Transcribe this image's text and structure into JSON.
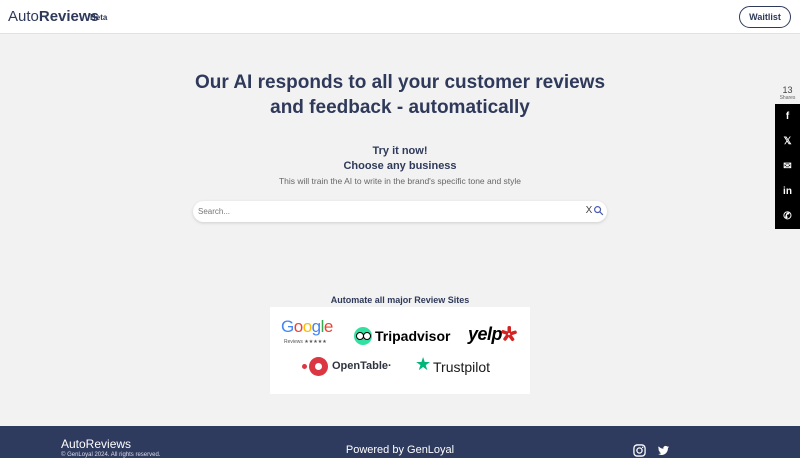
{
  "header": {
    "brand_light": "Auto",
    "brand_bold": "Reviews",
    "beta": "Beta",
    "waitlist_label": "Waitlist"
  },
  "hero": {
    "title_line1": "Our AI responds to all your customer reviews",
    "title_line2": "and feedback - automatically",
    "try_now": "Try it now!",
    "choose": "Choose any business",
    "train": "This will train the AI to write in the brand's specific tone and style"
  },
  "search": {
    "placeholder": "Search...",
    "value": "",
    "clear_glyph": "X"
  },
  "review_sites": {
    "heading": "Automate all major Review Sites",
    "google": "Google",
    "google_sub": "Reviews ★★★★★",
    "tripadvisor": "Tripadvisor",
    "yelp": "yelp",
    "opentable": "OpenTable·",
    "trustpilot": "Trustpilot"
  },
  "share": {
    "count": "13",
    "label": "Shares",
    "buttons": [
      {
        "icon": "facebook-icon",
        "glyph": "f"
      },
      {
        "icon": "x-icon",
        "glyph": "𝕏"
      },
      {
        "icon": "email-icon",
        "glyph": "✉"
      },
      {
        "icon": "linkedin-icon",
        "glyph": "in"
      },
      {
        "icon": "whatsapp-icon",
        "glyph": "✆"
      }
    ]
  },
  "footer": {
    "brand": "AutoReviews",
    "copyright": "© GenLoyal 2024. All rights reserved.",
    "powered": "Powered by GenLoyal"
  },
  "colors": {
    "primary": "#2e3a5e",
    "background": "#f2f2f2",
    "tripadvisor": "#34e0a1",
    "yelp": "#d32323",
    "opentable": "#da3743",
    "trustpilot": "#00b67a"
  }
}
